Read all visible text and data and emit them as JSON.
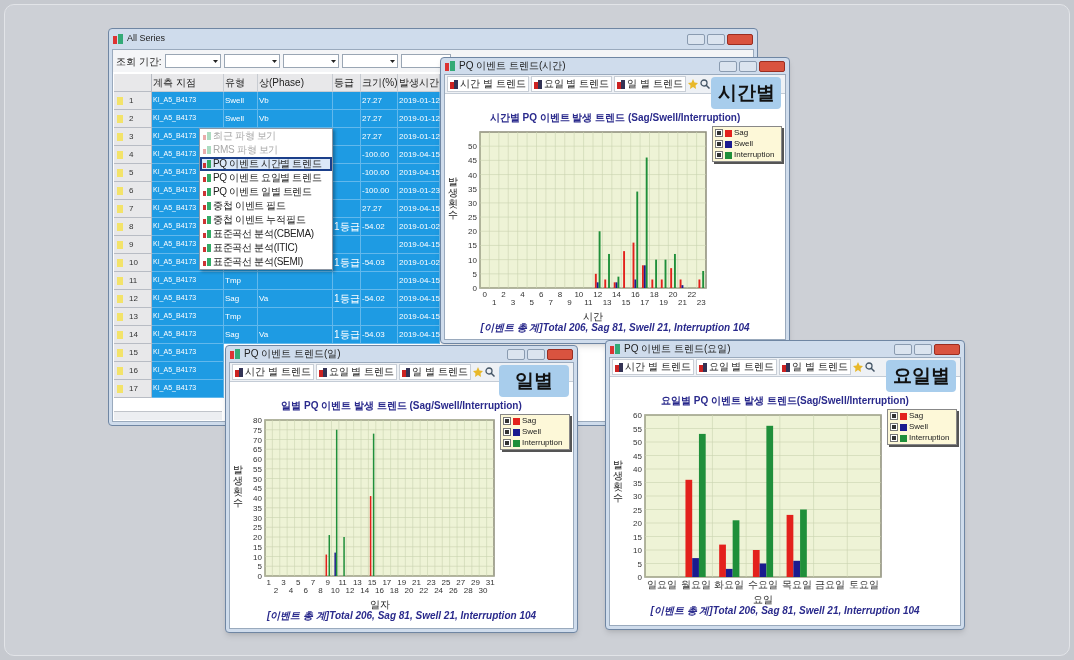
{
  "main_window": {
    "title": "All Series",
    "filter_label": "조회 기간:",
    "columns": [
      "계측 지점",
      "유형",
      "상(Phase)",
      "등급",
      "크기(%)",
      "발생시간"
    ],
    "rows": [
      {
        "number": "1",
        "site": "KI_A5_B4173",
        "type": "Swell",
        "phase": "Vb",
        "magnitude": "27.27",
        "date": "2019-01-12"
      },
      {
        "number": "2",
        "site": "KI_A5_B4173",
        "type": "Swell",
        "phase": "Vb",
        "magnitude": "27.27",
        "date": "2019-01-12"
      },
      {
        "number": "3",
        "site": "KI_A5_B4173",
        "magnitude": "27.27",
        "date": "2019-01-12"
      },
      {
        "number": "4",
        "site": "KI_A5_B4173",
        "magnitude": "-100.00",
        "date": "2019-04-15"
      },
      {
        "number": "5",
        "site": "KI_A5_B4173",
        "magnitude": "-100.00",
        "date": "2019-04-15"
      },
      {
        "number": "6",
        "site": "KI_A5_B4173",
        "magnitude": "-100.00",
        "date": "2019-01-23"
      },
      {
        "number": "7",
        "site": "KI_A5_B4173",
        "magnitude": "27.27",
        "date": "2019-04-15"
      },
      {
        "number": "8",
        "site": "KI_A5_B4173",
        "grade": "1등급",
        "magnitude": "-54.02",
        "date": "2019-01-02"
      },
      {
        "number": "9",
        "site": "KI_A5_B4173",
        "date": "2019-04-15"
      },
      {
        "number": "10",
        "site": "KI_A5_B4173",
        "grade": "1등급",
        "magnitude": "-54.03",
        "date": "2019-01-02"
      },
      {
        "number": "11",
        "site": "KI_A5_B4173",
        "type": "Tmp",
        "date": "2019-04-15"
      },
      {
        "number": "12",
        "site": "KI_A5_B4173",
        "type": "Sag",
        "phase": "Va",
        "grade": "1등급",
        "magnitude": "-54.02",
        "date": "2019-04-15"
      },
      {
        "number": "13",
        "site": "KI_A5_B4173",
        "type": "Tmp",
        "date": "2019-04-15"
      },
      {
        "number": "14",
        "site": "KI_A5_B4173",
        "type": "Sag",
        "phase": "Va",
        "grade": "1등급",
        "magnitude": "-54.03",
        "date": "2019-04-15"
      },
      {
        "number": "15",
        "site": "KI_A5_B4173"
      },
      {
        "number": "16",
        "site": "KI_A5_B4173"
      },
      {
        "number": "17",
        "site": "KI_A5_B4173"
      }
    ]
  },
  "context_menu": [
    {
      "label": "최근 파형 보기",
      "disabled": true,
      "selected": false
    },
    {
      "label": "RMS 파형 보기",
      "disabled": true,
      "selected": false
    },
    {
      "label": "PQ 이벤트 시간별 트렌드",
      "disabled": false,
      "selected": true
    },
    {
      "label": "PQ 이벤트 요일별 트렌드",
      "disabled": false,
      "selected": false
    },
    {
      "label": "PQ 이벤트 일별 트렌드",
      "disabled": false,
      "selected": false
    },
    {
      "label": "중첩 이벤트 필드",
      "disabled": false,
      "selected": false
    },
    {
      "label": "중첩 이벤트 누적필드",
      "disabled": false,
      "selected": false
    },
    {
      "label": "표준곡선 분석(CBEMA)",
      "disabled": false,
      "selected": false
    },
    {
      "label": "표준곡선 분석(ITIC)",
      "disabled": false,
      "selected": false
    },
    {
      "label": "표준곡선 분석(SEMI)",
      "disabled": false,
      "selected": false
    }
  ],
  "chart_windows": [
    {
      "title": "PQ 이벤트 트렌드(시간)",
      "badge": "시간별",
      "toolbar": [
        "시간 별 트렌드",
        "요일 별 트렌드",
        "일 별 트렌드"
      ],
      "legend": [
        {
          "checked": true
        },
        {
          "checked": true
        },
        {
          "checked": true
        }
      ],
      "chart_data": {
        "type": "bar",
        "title": "시간별 PQ 이벤트 발생 트렌드 (Sag/Swell/Interruption)",
        "xlabel": "시간",
        "ylabel": "발생 횟수",
        "grid": true,
        "categories": [
          "0",
          "1",
          "2",
          "3",
          "4",
          "5",
          "6",
          "7",
          "8",
          "9",
          "10",
          "11",
          "12",
          "13",
          "14",
          "15",
          "16",
          "17",
          "18",
          "19",
          "20",
          "21",
          "22",
          "23"
        ],
        "series": [
          {
            "name": "Sag",
            "color": "#e3211c",
            "values": [
              0,
              0,
              0,
              0,
              0,
              0,
              0,
              0,
              0,
              0,
              0,
              0,
              5,
              3,
              2,
              13,
              16,
              8,
              3,
              3,
              7,
              3,
              0,
              3
            ]
          },
          {
            "name": "Swell",
            "color": "#1b1b8f",
            "values": [
              0,
              0,
              0,
              0,
              0,
              0,
              0,
              0,
              0,
              0,
              0,
              0,
              2,
              0,
              2,
              0,
              3,
              8,
              0,
              0,
              0,
              1,
              0,
              0
            ]
          },
          {
            "name": "Interruption",
            "color": "#1f8f3a",
            "values": [
              0,
              0,
              0,
              0,
              0,
              0,
              0,
              0,
              0,
              0,
              0,
              0,
              20,
              12,
              4,
              0,
              34,
              46,
              10,
              10,
              12,
              0,
              0,
              6
            ]
          }
        ],
        "ylim": [
          0,
          55
        ],
        "yticks": [
          0,
          5,
          10,
          15,
          20,
          25,
          30,
          35,
          40,
          45,
          50
        ]
      },
      "footer": "[이벤트 총 계]Total 206, Sag 81, Swell 21, Interruption 104"
    },
    {
      "title": "PQ 이벤트 트렌드(일)",
      "badge": "일별",
      "toolbar": [
        "시간 별 트렌드",
        "요일 별 트렌드",
        "일 별 트렌드"
      ],
      "legend": [
        {
          "checked": true
        },
        {
          "checked": true
        },
        {
          "checked": true
        }
      ],
      "chart_data": {
        "type": "bar",
        "title": "일별 PQ 이벤트 발생 트렌드 (Sag/Swell/Interruption)",
        "xlabel": "일자",
        "ylabel": "발생 횟수",
        "grid": true,
        "categories": [
          "1",
          "2",
          "3",
          "4",
          "5",
          "6",
          "7",
          "8",
          "9",
          "10",
          "11",
          "12",
          "13",
          "14",
          "15",
          "16",
          "17",
          "18",
          "19",
          "20",
          "21",
          "22",
          "23",
          "24",
          "25",
          "26",
          "27",
          "28",
          "29",
          "30",
          "31"
        ],
        "series": [
          {
            "name": "Sag",
            "color": "#e3211c",
            "values": [
              0,
              0,
              0,
              0,
              0,
              0,
              0,
              0,
              11,
              0,
              0,
              0,
              0,
              0,
              41,
              0,
              0,
              0,
              0,
              0,
              0,
              0,
              0,
              0,
              0,
              0,
              0,
              0,
              0,
              0,
              0
            ]
          },
          {
            "name": "Swell",
            "color": "#1b1b8f",
            "values": [
              0,
              0,
              0,
              0,
              0,
              0,
              0,
              0,
              0,
              12,
              0,
              0,
              0,
              0,
              0,
              0,
              0,
              0,
              0,
              0,
              0,
              0,
              0,
              0,
              0,
              0,
              0,
              0,
              0,
              0,
              0
            ]
          },
          {
            "name": "Interruption",
            "color": "#1f8f3a",
            "values": [
              0,
              0,
              0,
              0,
              0,
              0,
              0,
              0,
              21,
              75,
              20,
              0,
              0,
              0,
              73,
              0,
              0,
              0,
              0,
              0,
              0,
              0,
              0,
              0,
              0,
              0,
              0,
              0,
              0,
              0,
              0
            ]
          }
        ],
        "ylim": [
          0,
          80
        ],
        "yticks": [
          0,
          5,
          10,
          15,
          20,
          25,
          30,
          35,
          40,
          45,
          50,
          55,
          60,
          65,
          70,
          75,
          80
        ]
      },
      "footer": "[이벤트 총 계]Total 206, Sag 81, Swell 21, Interruption 104"
    },
    {
      "title": "PQ 이벤트 트렌드(요일)",
      "badge": "요일별",
      "toolbar": [
        "시간 별 트렌드",
        "요일 별 트렌드",
        "일 별 트렌드"
      ],
      "legend": [
        {
          "checked": true
        },
        {
          "checked": true
        },
        {
          "checked": true
        }
      ],
      "chart_data": {
        "type": "bar",
        "title": "요일별 PQ 이벤트 발생 트렌드(Sag/Swell/Interruption)",
        "xlabel": "요일",
        "ylabel": "발생 횟수",
        "grid": true,
        "categories": [
          "일요일",
          "월요일",
          "화요일",
          "수요일",
          "목요일",
          "금요일",
          "토요일"
        ],
        "series": [
          {
            "name": "Sag",
            "color": "#e3211c",
            "values": [
              0,
              36,
              12,
              10,
              23,
              0,
              0
            ]
          },
          {
            "name": "Swell",
            "color": "#1b1b8f",
            "values": [
              0,
              7,
              3,
              5,
              6,
              0,
              0
            ]
          },
          {
            "name": "Interruption",
            "color": "#1f8f3a",
            "values": [
              0,
              53,
              21,
              56,
              25,
              0,
              0
            ]
          }
        ],
        "ylim": [
          0,
          60
        ],
        "yticks": [
          0,
          5,
          10,
          15,
          20,
          25,
          30,
          35,
          40,
          45,
          50,
          55,
          60
        ]
      },
      "footer": "[이벤트 총 계]Total 206, Sag 81, Swell 21, Interruption 104"
    }
  ]
}
